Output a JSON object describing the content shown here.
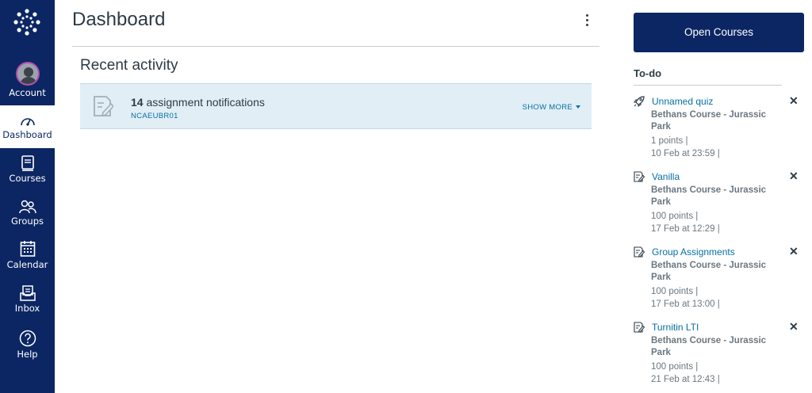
{
  "nav": {
    "items": [
      {
        "label": "Account",
        "icon": "avatar"
      },
      {
        "label": "Dashboard",
        "icon": "dashboard-icon"
      },
      {
        "label": "Courses",
        "icon": "courses-icon"
      },
      {
        "label": "Groups",
        "icon": "groups-icon"
      },
      {
        "label": "Calendar",
        "icon": "calendar-icon"
      },
      {
        "label": "Inbox",
        "icon": "inbox-icon"
      },
      {
        "label": "Help",
        "icon": "help-icon"
      }
    ],
    "active": "Dashboard",
    "bg_color": "#0c2663"
  },
  "main": {
    "title": "Dashboard",
    "recent_heading": "Recent activity",
    "notification": {
      "count": "14",
      "text": " assignment notifications",
      "code": "NCAEUBR01",
      "show_more": "SHOW MORE"
    }
  },
  "sidebar": {
    "open_courses": "Open Courses",
    "todo_heading": "To-do",
    "todos": [
      {
        "icon": "rocket-quiz-icon",
        "title": "Unnamed quiz",
        "course": "Bethans Course - Jurassic Park",
        "points": "1 points  |",
        "date": "10 Feb at 23:59  |"
      },
      {
        "icon": "assignment-icon",
        "title": "Vanilla",
        "course": "Bethans Course - Jurassic Park",
        "points": "100 points  |",
        "date": "17 Feb at 12:29  |"
      },
      {
        "icon": "assignment-icon",
        "title": "Group Assignments",
        "course": "Bethans Course - Jurassic Park",
        "points": "100 points  |",
        "date": "17 Feb at 13:00  |"
      },
      {
        "icon": "assignment-icon",
        "title": "Turnitin LTI",
        "course": "Bethans Course - Jurassic Park",
        "points": "100 points  |",
        "date": "21 Feb at 12:43  |"
      }
    ],
    "close_glyph": "✕"
  }
}
